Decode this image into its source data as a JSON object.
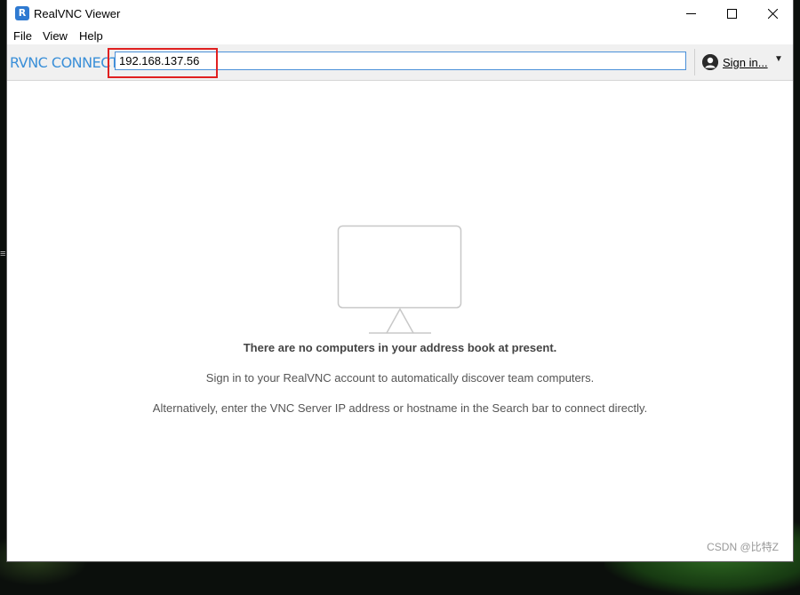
{
  "window": {
    "title": "RealVNC Viewer",
    "app_icon_letter": "R"
  },
  "menu": {
    "items": [
      "File",
      "View",
      "Help"
    ]
  },
  "toolbar": {
    "brand": "RVNC CONNECT",
    "search_value": "192.168.137.56",
    "signin_label": "Sign in...",
    "signin_caret": "▼"
  },
  "main": {
    "title": "There are no computers in your address book at present.",
    "line1": "Sign in to your RealVNC account to automatically discover team computers.",
    "line2": "Alternatively, enter the VNC Server IP address or hostname in the Search bar to connect directly."
  },
  "overlay": {
    "watermark": "CSDN @比特Z",
    "edge_glyph": "≡"
  },
  "colors": {
    "brand": "#3a8fd8",
    "input_border": "#4a90d9",
    "highlight": "#e02020"
  }
}
